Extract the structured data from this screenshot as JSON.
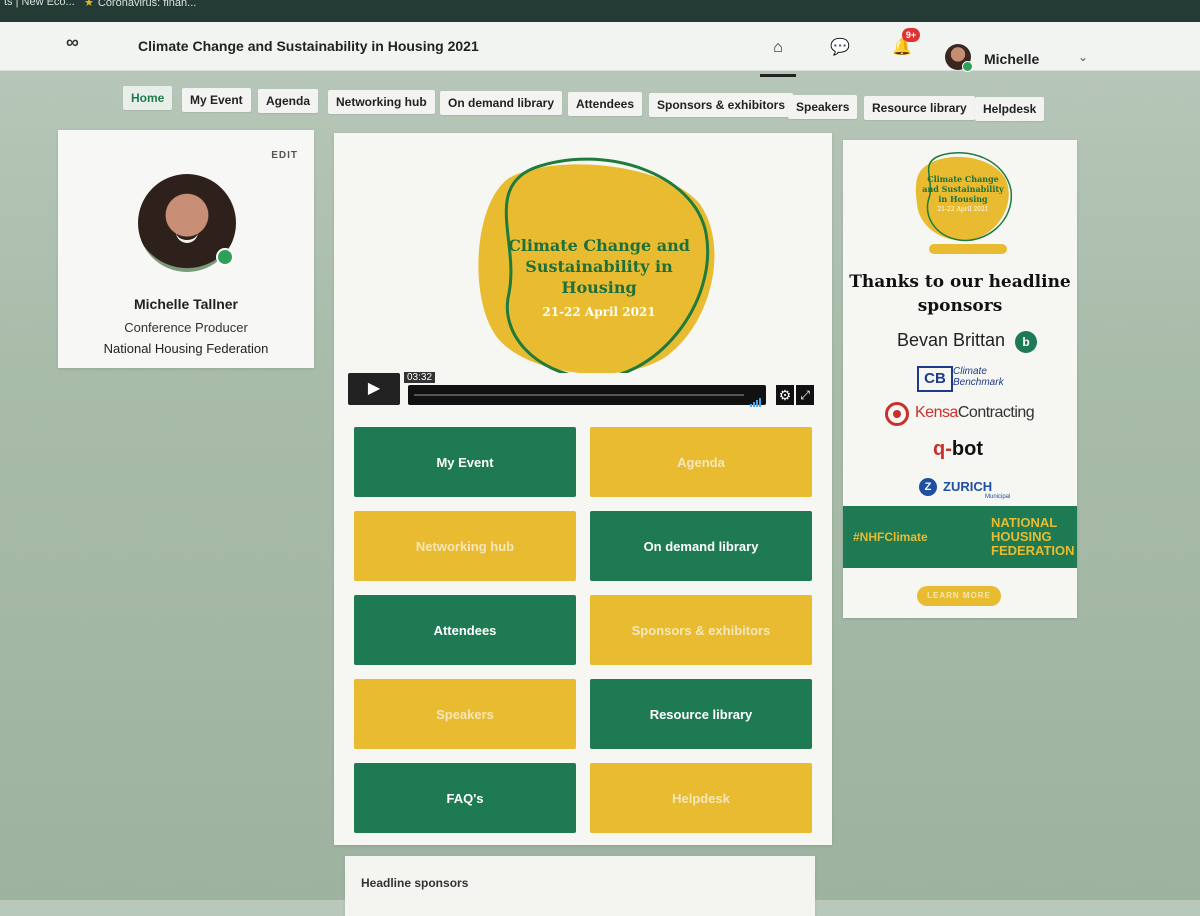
{
  "browser": {
    "tab1": "ts | New Eco...",
    "tab2": "Coronavirus: finan..."
  },
  "header": {
    "logo": "∞",
    "event_title": "Climate Change and Sustainability in Housing 2021",
    "notification_badge": "9+",
    "user_name": "Michelle"
  },
  "nav": {
    "items": [
      {
        "label": "Home",
        "active": true
      },
      {
        "label": "My Event"
      },
      {
        "label": "Agenda"
      },
      {
        "label": "Networking hub"
      },
      {
        "label": "On demand library"
      },
      {
        "label": "Attendees"
      },
      {
        "label": "Sponsors & exhibitors"
      },
      {
        "label": "Speakers"
      },
      {
        "label": "Resource library"
      },
      {
        "label": "Helpdesk"
      }
    ]
  },
  "profile": {
    "edit_label": "EDIT",
    "name": "Michelle Tallner",
    "role": "Conference Producer",
    "organization": "National Housing Federation",
    "status": "online"
  },
  "hero": {
    "title": "Climate Change and Sustainability in Housing",
    "date": "21-22 April 2021"
  },
  "video": {
    "timecode": "03:32"
  },
  "tiles": [
    {
      "label": "My Event",
      "color": "green"
    },
    {
      "label": "Agenda",
      "color": "yellow"
    },
    {
      "label": "Networking hub",
      "color": "yellow"
    },
    {
      "label": "On demand library",
      "color": "green"
    },
    {
      "label": "Attendees",
      "color": "green"
    },
    {
      "label": "Sponsors & exhibitors",
      "color": "yellow"
    },
    {
      "label": "Speakers",
      "color": "yellow"
    },
    {
      "label": "Resource library",
      "color": "green"
    },
    {
      "label": "FAQ's",
      "color": "green"
    },
    {
      "label": "Helpdesk",
      "color": "yellow"
    }
  ],
  "headline_sponsors_label": "Headline sponsors",
  "sponsor_panel": {
    "logo_title": "Climate Change and Sustainability in Housing",
    "logo_date": "21-22 April 2021",
    "thanks": "Thanks to our headline sponsors",
    "sponsors": {
      "bevan": "Bevan Brittan",
      "cb_mark": "CB",
      "cb_text_1": "Climate",
      "cb_text_2": "Benchmark",
      "kensa_1": "Kensa",
      "kensa_2": "Contracting",
      "qbot": "bot",
      "qbot_q": "q-",
      "zurich": "ZURICH",
      "zurich_sub": "Municipal"
    },
    "hashtag": "#NHFClimate",
    "nhf_1": "NATIONAL",
    "nhf_2": "HOUSING",
    "nhf_3": "FEDERATION",
    "learn_more": "LEARN MORE"
  },
  "colors": {
    "brand_green": "#1e7a52",
    "brand_yellow": "#e8bb30"
  }
}
